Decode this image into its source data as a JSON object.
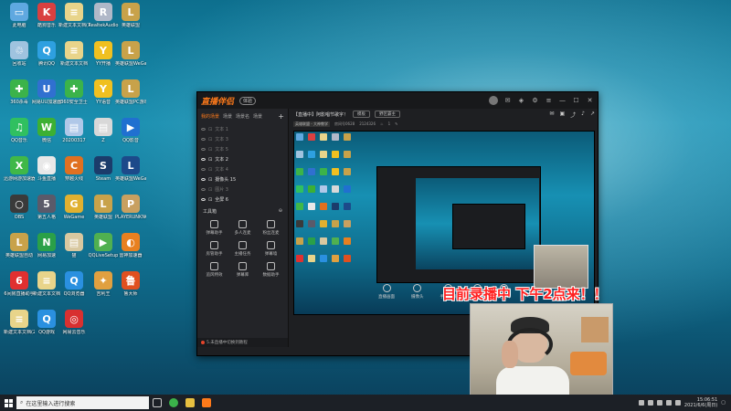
{
  "desktop": {
    "icons": [
      {
        "label": "此电脑",
        "color": "#5fa8e0",
        "glyph": "▭"
      },
      {
        "label": "酷狗音乐",
        "color": "#d94040",
        "glyph": "K"
      },
      {
        "label": "新建文本文档(1)",
        "color": "#e8d48a",
        "glyph": "≡"
      },
      {
        "label": "RealtekAudio",
        "color": "#b0b8c8",
        "glyph": "R"
      },
      {
        "label": "英雄联盟",
        "color": "#c8a24a",
        "glyph": "L"
      },
      {
        "label": "回收站",
        "color": "#9fc3df",
        "glyph": "♲"
      },
      {
        "label": "腾讯QQ",
        "color": "#2ea0e0",
        "glyph": "Q"
      },
      {
        "label": "新建文本文档",
        "color": "#e8d48a",
        "glyph": "≡"
      },
      {
        "label": "YY开播",
        "color": "#f0c020",
        "glyph": "Y"
      },
      {
        "label": "英雄联盟WeGame版",
        "color": "#c8a24a",
        "glyph": "L"
      },
      {
        "label": "360杀毒",
        "color": "#3bb34a",
        "glyph": "✚"
      },
      {
        "label": "网易UU加速器",
        "color": "#3070d0",
        "glyph": "U"
      },
      {
        "label": "360安全卫士",
        "color": "#3bb34a",
        "glyph": "✚"
      },
      {
        "label": "YY语音",
        "color": "#f0c020",
        "glyph": "Y"
      },
      {
        "label": "英雄联盟PC游戏机器人",
        "color": "#c8a24a",
        "glyph": "L"
      },
      {
        "label": "QQ音乐",
        "color": "#30c060",
        "glyph": "♫"
      },
      {
        "label": "微信",
        "color": "#3cb034",
        "glyph": "W"
      },
      {
        "label": "20200317",
        "color": "#b0c8e8",
        "glyph": "▤"
      },
      {
        "label": "Z",
        "color": "#d8d8d8",
        "glyph": "▤"
      },
      {
        "label": "QQ影音",
        "color": "#2070d0",
        "glyph": "▶"
      },
      {
        "label": "迅游网游加速器",
        "color": "#40b848",
        "glyph": "X"
      },
      {
        "label": "斗鱼直播",
        "color": "#e8e8e8",
        "glyph": "◉"
      },
      {
        "label": "穿越火线",
        "color": "#e07020",
        "glyph": "C"
      },
      {
        "label": "Steam",
        "color": "#1b3c6b",
        "glyph": "S"
      },
      {
        "label": "英雄联盟WeGame版",
        "color": "#1c4a8a",
        "glyph": "L"
      },
      {
        "label": "OBS",
        "color": "#3a3a3a",
        "glyph": "○"
      },
      {
        "label": "第五人格",
        "color": "#5a5a6a",
        "glyph": "5"
      },
      {
        "label": "WeGame",
        "color": "#e0b030",
        "glyph": "G"
      },
      {
        "label": "英雄联盟",
        "color": "#c8a24a",
        "glyph": "L"
      },
      {
        "label": "PLAYERUNKNOWN'S BATTLEGR...",
        "color": "#c8a060",
        "glyph": "P"
      },
      {
        "label": "英雄联盟自动",
        "color": "#c8a24a",
        "glyph": "L"
      },
      {
        "label": "网易加速",
        "color": "#2aa048",
        "glyph": "N"
      },
      {
        "label": "猫",
        "color": "#d8c8a0",
        "glyph": "▤"
      },
      {
        "label": "QQLiveSetup",
        "color": "#50b050",
        "glyph": "▶"
      },
      {
        "label": "雷神加速器",
        "color": "#e88020",
        "glyph": "◐"
      },
      {
        "label": "6间房直播助手",
        "color": "#e03030",
        "glyph": "6"
      },
      {
        "label": "新建文本文档",
        "color": "#e8d48a",
        "glyph": "≡"
      },
      {
        "label": "QQ浏览器",
        "color": "#2a90e0",
        "glyph": "Q"
      },
      {
        "label": "吉利王",
        "color": "#e0a040",
        "glyph": "✦"
      },
      {
        "label": "鲁大师",
        "color": "#e05020",
        "glyph": "鲁"
      },
      {
        "label": "新建文本文档(2)",
        "color": "#e8d48a",
        "glyph": "≡"
      },
      {
        "label": "QQ游戏",
        "color": "#2a90e0",
        "glyph": "Q"
      },
      {
        "label": "网易云音乐",
        "color": "#d83030",
        "glyph": "◎"
      }
    ]
  },
  "app": {
    "name": "直播伴侣",
    "badge": "体验",
    "scene_tabs": [
      "我的场景",
      "场景",
      "场景名",
      "场景"
    ],
    "sources": [
      {
        "label": "文本 1",
        "on": false
      },
      {
        "label": "文本 3",
        "on": false
      },
      {
        "label": "文本 5",
        "on": false
      },
      {
        "label": "文本 2",
        "on": true
      },
      {
        "label": "文本 4",
        "on": false
      },
      {
        "label": "摄像头 15",
        "on": true
      },
      {
        "label": "图片 3",
        "on": false
      },
      {
        "label": "全屏 6",
        "on": true
      }
    ],
    "tools_title": "工具箱",
    "tools": [
      {
        "label": "弹幕助手"
      },
      {
        "label": "多人连麦"
      },
      {
        "label": "粉丝连麦"
      },
      {
        "label": "房管助手"
      },
      {
        "label": "主播任务"
      },
      {
        "label": "弹幕墙"
      },
      {
        "label": "追风特效"
      },
      {
        "label": "弹幕库"
      },
      {
        "label": "数据助手"
      }
    ],
    "footer_text": "5.未直播中切换到教程",
    "stream_title": "【直播中】阿影唱节歌字！",
    "stream_pill": "模板",
    "category": "野区霸主",
    "meta_tag": "英雄联盟 - 大神教学",
    "meta_id": "房间号0628",
    "meta_views": "2124326",
    "meta_num": "1",
    "bottom_tools": [
      "直播画面",
      "摄像头",
      "手机投屏",
      "录屏",
      "麦克风"
    ]
  },
  "overlay": {
    "text": "目前录播中 下午2点来！！"
  },
  "taskbar": {
    "search_placeholder": "在这里输入进行搜索",
    "time": "15:06:51",
    "date": "2021/6/6(周日)"
  }
}
